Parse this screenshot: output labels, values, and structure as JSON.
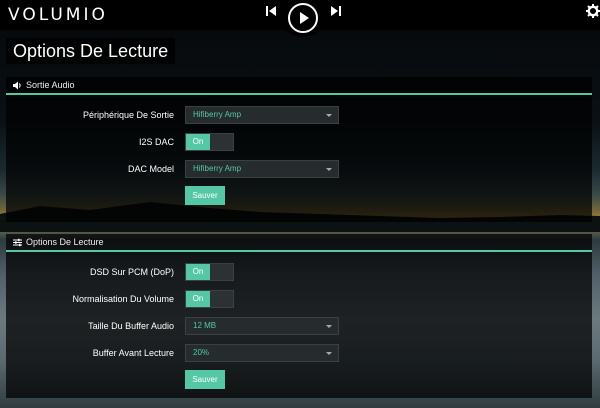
{
  "header": {
    "logo": "VOLUMIO",
    "prev_icon": "skip-previous-icon",
    "play_icon": "play-icon",
    "next_icon": "skip-next-icon",
    "settings_icon": "gear-icon"
  },
  "page_title": "Options De Lecture",
  "audio_output": {
    "title": "Sortie Audio",
    "icon": "speaker-icon",
    "fields": {
      "device_label": "Périphérique De Sortie",
      "device_value": "Hifiberry Amp",
      "i2s_label": "I2S DAC",
      "i2s_state": "On",
      "dac_label": "DAC Model",
      "dac_value": "Hifiberry Amp"
    },
    "save_label": "Sauver"
  },
  "playback_options": {
    "title": "Options De Lecture",
    "icon": "sliders-icon",
    "fields": {
      "dsd_label": "DSD Sur PCM (DoP)",
      "dsd_state": "On",
      "norm_label": "Normalisation Du Volume",
      "norm_state": "On",
      "buffer_label": "Taille Du Buffer Audio",
      "buffer_value": "12 MB",
      "prebuffer_label": "Buffer Avant Lecture",
      "prebuffer_value": "20%"
    },
    "save_label": "Sauver"
  },
  "colors": {
    "accent": "#54c8a4",
    "topbar": "#000000"
  }
}
